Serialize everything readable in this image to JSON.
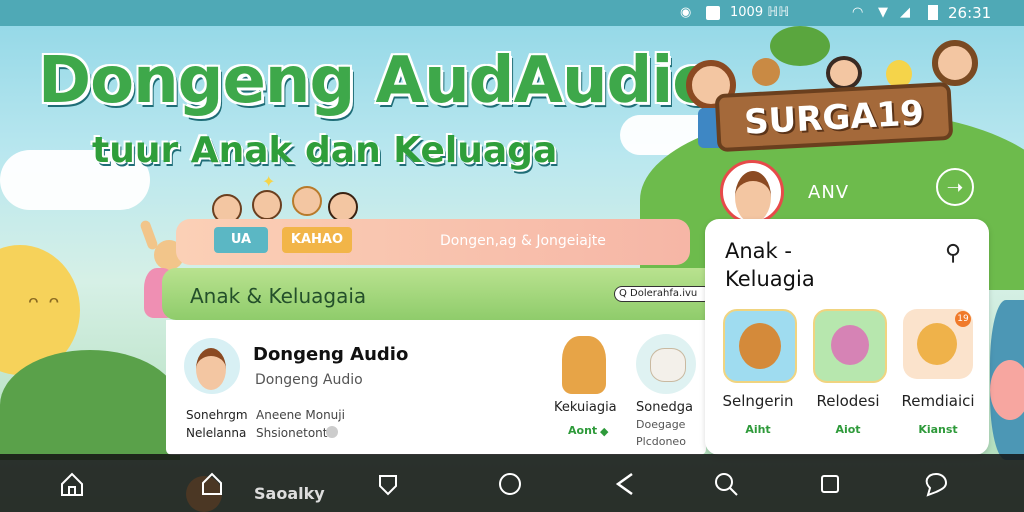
{
  "status_bar": {
    "left_text": "1009 ℍℍ",
    "time": "26:31"
  },
  "hero": {
    "title": "Dongeng AudAudio",
    "subtitle": "tuur Anak dan Keluaga"
  },
  "signboard": {
    "text": "SURGA19"
  },
  "banner": {
    "sign_left": "UA",
    "sign_right": "KAHAO",
    "text": "Dongen,ag & Jongeiajte"
  },
  "category_bar": {
    "title": "Anak & Keluagaia",
    "pill": "Q Dolerahfa.ivu"
  },
  "card": {
    "item": {
      "title": "Dongeng Audio",
      "subtitle": "Dongeng Audio"
    },
    "meta": {
      "line1_a": "Sonehrgm",
      "line1_b": "Aneene Monuji",
      "line2_a": "Nelelanna",
      "line2_b": "Shsionetonto"
    },
    "thumbs": [
      {
        "label": "Kekuiagia",
        "tag": "Aont"
      },
      {
        "label": "Sonedga",
        "line2": "Doegage",
        "line3": "Plcdoneo"
      }
    ]
  },
  "profile": {
    "label": "ANV"
  },
  "panel": {
    "title": "Anak - Keluagia",
    "tiles": [
      {
        "label": "Selngerin",
        "tag": "Aiht"
      },
      {
        "label": "Relodesi",
        "tag": "Aiot"
      },
      {
        "label": "Remdiaici",
        "tag": "Kianst",
        "badge": "19"
      }
    ]
  },
  "peek": {
    "label": "Saoalky"
  },
  "colors": {
    "accent_green": "#3ea84a",
    "status_bar": "#4fa9b6",
    "nav_bar": "#141414"
  },
  "icons": [
    "home-icon",
    "home-outline-icon",
    "back-triangle-icon",
    "circle-home-icon",
    "back-arrow-icon",
    "search-icon",
    "square-recents-icon",
    "tag-icon",
    "arrow-forward-icon"
  ]
}
